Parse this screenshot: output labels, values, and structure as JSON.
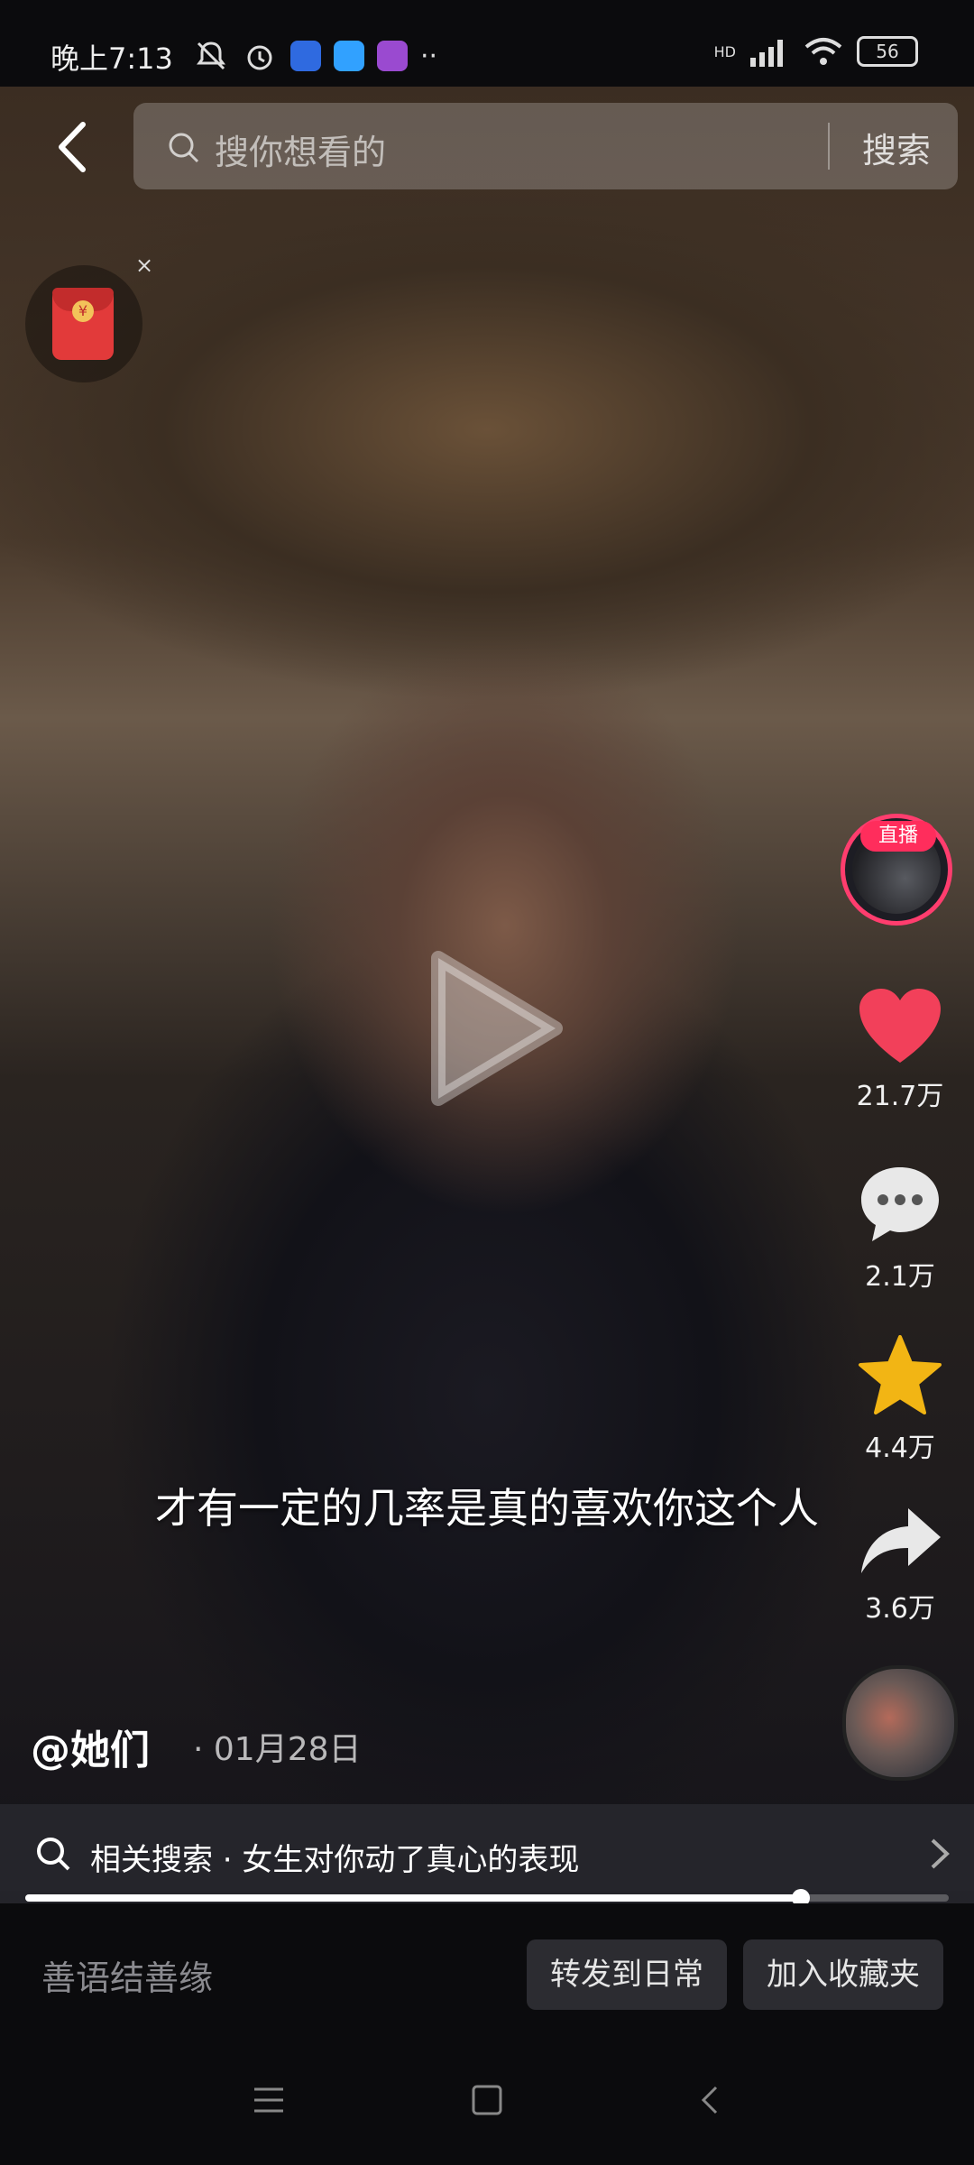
{
  "status_bar": {
    "time": "晚上7:13",
    "network": "HD",
    "battery": "56",
    "app_icon_colors": [
      "#e9d6a0",
      "#6f57e8",
      "#31a1ff",
      "#b05bd6"
    ]
  },
  "search": {
    "placeholder": "搜你想看的",
    "submit_label": "搜索"
  },
  "live": {
    "badge": "直播"
  },
  "actions": {
    "like_count": "21.7万",
    "comment_count": "2.1万",
    "favorite_count": "4.4万",
    "share_count": "3.6万"
  },
  "video": {
    "caption": "才有一定的几率是真的喜欢你这个人",
    "author": "@她们",
    "date": "· 01月28日",
    "progress": 0.84
  },
  "related": {
    "text": "相关搜索 · 女生对你动了真心的表现"
  },
  "bottom": {
    "comment_placeholder": "善语结善缘",
    "forward_label": "转发到日常",
    "collect_label": "加入收藏夹"
  },
  "colors": {
    "like": "#f2405a",
    "favorite": "#f2b514",
    "live_ring": "#ff3d6e"
  }
}
